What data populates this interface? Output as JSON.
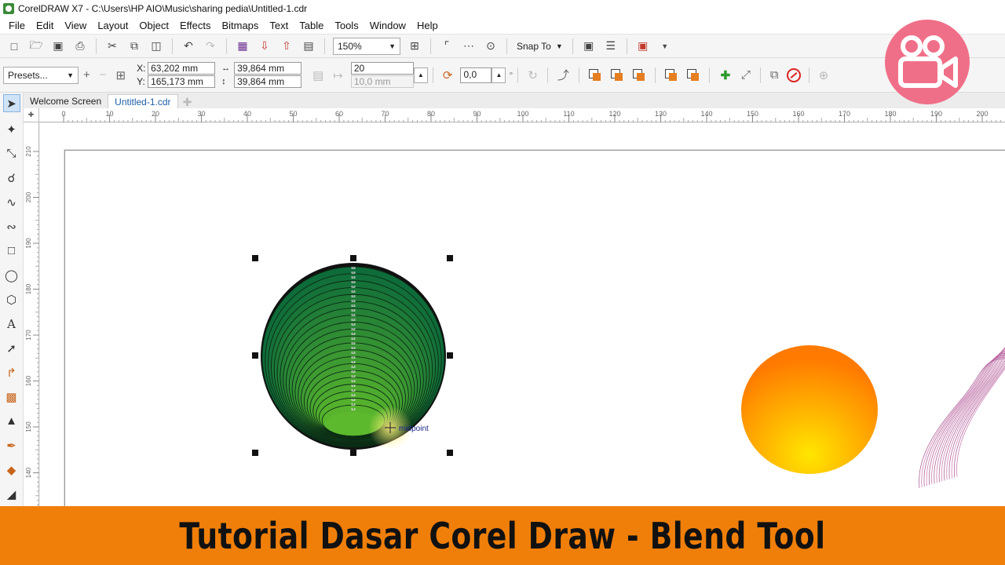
{
  "window": {
    "title": "CorelDRAW X7 - C:\\Users\\HP AIO\\Music\\sharing pedia\\Untitled-1.cdr"
  },
  "menu": [
    "File",
    "Edit",
    "View",
    "Layout",
    "Object",
    "Effects",
    "Bitmaps",
    "Text",
    "Table",
    "Tools",
    "Window",
    "Help"
  ],
  "toolbar": {
    "zoom": "150%",
    "snap_label": "Snap To"
  },
  "properties": {
    "presets": "Presets...",
    "x": "63,202 mm",
    "y": "165,173 mm",
    "width": "39,864 mm",
    "height": "39,864 mm",
    "blend_steps": "20",
    "blend_spacing": "10,0 mm",
    "blend_angle": "0,0",
    "angle_unit": "°"
  },
  "tabs": [
    "Welcome Screen",
    "Untitled-1.cdr"
  ],
  "ruler": {
    "h": [
      "0",
      "10",
      "20",
      "30",
      "40",
      "50",
      "60",
      "70",
      "80",
      "90",
      "100",
      "110",
      "120",
      "130",
      "140",
      "150",
      "160",
      "170",
      "180",
      "190",
      "200"
    ],
    "v": [
      "210",
      "200",
      "190",
      "180",
      "170",
      "160",
      "150",
      "140"
    ],
    "units": "millimeters"
  },
  "canvas": {
    "cursor_hint": "midpoint"
  },
  "colors": {
    "blend_start": "#0e6b3a",
    "blend_end": "#5cb82c",
    "sphere_top": "#ff7a00",
    "sphere_bottom": "#ffe600",
    "accent_banner": "#f07f0a",
    "badge": "#f06f88"
  },
  "banner": {
    "text": "Tutorial Dasar Corel Draw - Blend Tool"
  }
}
